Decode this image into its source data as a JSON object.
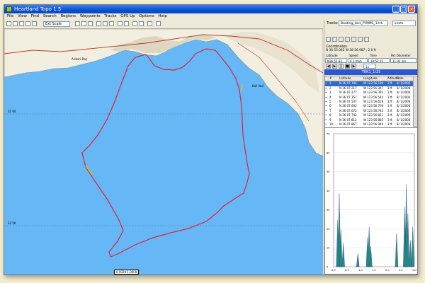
{
  "window": {
    "title": "Heartland Topo 1.5"
  },
  "menu": [
    "File",
    "View",
    "Find",
    "Search",
    "Regions",
    "Waypoints",
    "Tracks",
    "GPS Up",
    "Options",
    "Help"
  ],
  "toolbar": {
    "scale": "Ext Scale"
  },
  "map": {
    "lat_labels": [
      "32 60",
      "32 58"
    ],
    "scale_text": "0.0020 1.0000",
    "place_labels": [
      "Aribari Bay",
      "Kali Vasi"
    ],
    "colors": {
      "water": "#65b8f5",
      "track": "#e0203a",
      "land": "#f3efe0"
    }
  },
  "panel": {
    "tracks_label": "Tracks",
    "tracks_value": "Boating_test_PYMMS_1.trk",
    "units_value": "knots",
    "coordinates_label": "Coordinates",
    "coordinates_value": "N 36 55.062 W 38 26.987 ; 2.0 ft",
    "stats_headers": [
      "Latitude",
      "Speed",
      "Time",
      "Pkt Odometer"
    ],
    "stats_values": [
      "N36 55.62",
      "0.1 mph",
      "18:52:15",
      "11.92 nm"
    ],
    "speed_select": "1x",
    "track_name": "TRK1_1/25",
    "table_headers": [
      "#",
      "Latitude",
      "Longitude",
      "Altitude",
      "Date"
    ],
    "table_rows": [
      {
        "n": "1",
        "lat": "N 36 07.196",
        "lon": "W 123 56.199",
        "alt": "3 ft",
        "date": "8/ 1/2006"
      },
      {
        "n": "2",
        "lat": "N 36 07.217",
        "lon": "W 123 56.347",
        "alt": "3 ft",
        "date": "8/ 1/2006"
      },
      {
        "n": "3",
        "lat": "N 36 07.277",
        "lon": "W 123 56.391",
        "alt": "3 ft",
        "date": "8/ 1/2006"
      },
      {
        "n": "4",
        "lat": "N 36 07.357",
        "lon": "W 123 56.544",
        "alt": "3 ft",
        "date": "8/ 1/2006"
      },
      {
        "n": "5",
        "lat": "N 36 07.507",
        "lon": "W 123 56.628",
        "alt": "3 ft",
        "date": "8/ 1/2006"
      },
      {
        "n": "6",
        "lat": "N 36 07.602",
        "lon": "W 123 56.700",
        "alt": "3 ft",
        "date": "8/ 1/2006"
      },
      {
        "n": "7",
        "lat": "N 36 07.672",
        "lon": "W 123 56.742",
        "alt": "3 ft",
        "date": "8/ 1/2006"
      },
      {
        "n": "8",
        "lat": "N 36 07.742",
        "lon": "W 123 56.811",
        "alt": "3 ft",
        "date": "8/ 1/2006"
      },
      {
        "n": "9",
        "lat": "N 36 07.812",
        "lon": "W 123 56.885",
        "alt": "3 ft",
        "date": "8/ 1/2006"
      },
      {
        "n": "10",
        "lat": "N 36 07.867",
        "lon": "W 123 56.940",
        "alt": "3 ft",
        "date": "8/ 1/2006"
      }
    ],
    "graph_x_ticks": [
      "0.0",
      "0.5",
      "1.0",
      "1.5",
      "2.0",
      "2.5",
      "3.0"
    ],
    "graph_y_ticks": [
      "0",
      "10",
      "20",
      "30",
      "40",
      "50",
      "60",
      "70"
    ]
  }
}
